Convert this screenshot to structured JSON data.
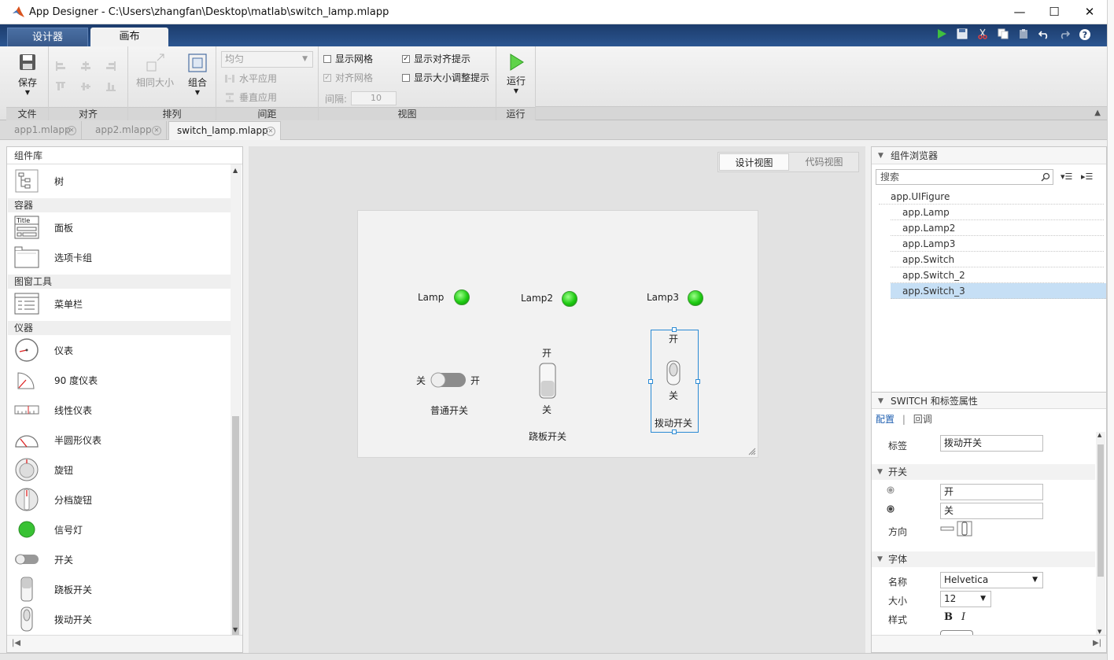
{
  "window": {
    "title": "App Designer - C:\\Users\\zhangfan\\Desktop\\matlab\\switch_lamp.mlapp",
    "minimize": "—",
    "maximize": "☐",
    "close": "✕"
  },
  "toolstrip_tabs": [
    {
      "label": "设计器"
    },
    {
      "label": "画布"
    }
  ],
  "ribbon": {
    "file": {
      "save_label": "保存",
      "title": "文件"
    },
    "align": {
      "title": "对齐"
    },
    "arrange": {
      "same_size": "相同大小",
      "group": "组合",
      "title": "排列"
    },
    "spacing": {
      "distribute_value": "均匀",
      "horizontal_apply": "水平应用",
      "vertical_apply": "垂直应用",
      "gap_label": "间隔:",
      "gap_value": "10",
      "title": "间距"
    },
    "view": {
      "show_grid": "显示网格",
      "snap_grid": "对齐网格",
      "show_align_hints": "显示对齐提示",
      "show_resize_hints": "显示大小调整提示",
      "title": "视图"
    },
    "run": {
      "run_label": "运行",
      "title": "运行"
    }
  },
  "file_tabs": [
    {
      "label": "app1.mlapp"
    },
    {
      "label": "app2.mlapp"
    },
    {
      "label": "switch_lamp.mlapp"
    }
  ],
  "library": {
    "header": "组件库",
    "sections": {
      "containers": "容器",
      "figure_tools": "图窗工具",
      "instruments": "仪器"
    },
    "items": {
      "tree": "树",
      "panel": "面板",
      "panel_icon_text": "Title",
      "tabgroup": "选项卡组",
      "menubar": "菜单栏",
      "gauge": "仪表",
      "gauge90": "90 度仪表",
      "linear_gauge": "线性仪表",
      "semicircular_gauge": "半圆形仪表",
      "knob": "旋钮",
      "discrete_knob": "分档旋钮",
      "lamp": "信号灯",
      "switch": "开关",
      "rocker_switch": "跷板开关",
      "toggle_switch": "拨动开关"
    }
  },
  "view_toggle": {
    "design": "设计视图",
    "code": "代码视图"
  },
  "canvas": {
    "lamp1": "Lamp",
    "lamp2": "Lamp2",
    "lamp3": "Lamp3",
    "switch1": {
      "off": "关",
      "on": "开",
      "label": "普通开关"
    },
    "switch2": {
      "on": "开",
      "off": "关",
      "label": "跷板开关"
    },
    "switch3": {
      "on": "开",
      "off": "关",
      "label": "拨动开关"
    }
  },
  "browser": {
    "header": "组件浏览器",
    "search_placeholder": "搜索",
    "items": [
      "app.UIFigure",
      "app.Lamp",
      "app.Lamp2",
      "app.Lamp3",
      "app.Switch",
      "app.Switch_2",
      "app.Switch_3"
    ]
  },
  "inspector": {
    "header": "SWITCH 和标签属性",
    "tabs": {
      "config": "配置",
      "callback": "回调"
    },
    "label_name": "标签",
    "label_value": "拨动开关",
    "section_switch": "开关",
    "item1_value": "开",
    "item2_value": "关",
    "orientation": "方向",
    "section_font": "字体",
    "font_name_label": "名称",
    "font_name_value": "Helvetica",
    "font_size_label": "大小",
    "font_size_value": "12",
    "font_style_label": "样式",
    "bold": "B",
    "italic": "I"
  },
  "colors": {
    "toolstrip": "#1c3c6c",
    "lamp_green": "#1ecb12",
    "selection": "#2a8ad4",
    "selected_row": "#c6dff5"
  }
}
